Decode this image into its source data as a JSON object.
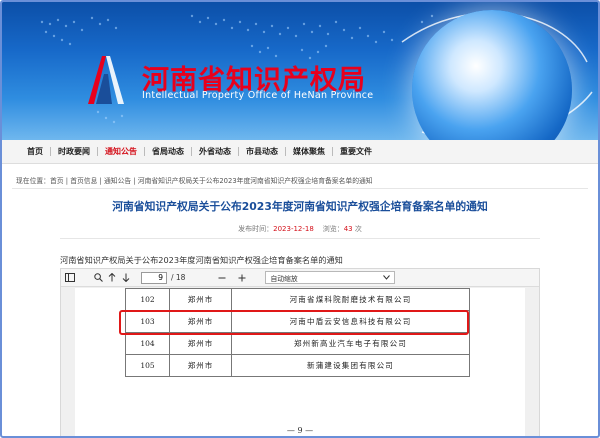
{
  "header": {
    "title_cn": "河南省知识产权局",
    "title_en": "Intellectual Property Office of HeNan Province"
  },
  "nav": {
    "items": [
      {
        "label": "首页"
      },
      {
        "label": "时政要闻"
      },
      {
        "label": "通知公告"
      },
      {
        "label": "省局动态"
      },
      {
        "label": "外省动态"
      },
      {
        "label": "市县动态"
      },
      {
        "label": "媒体聚焦"
      },
      {
        "label": "重要文件"
      }
    ],
    "active_index": 2
  },
  "breadcrumb": {
    "text": "现在位置：首页  |  首页信息  |  通知公告  |  河南省知识产权局关于公布2023年度河南省知识产权强企培育备案名单的通知"
  },
  "article": {
    "title": "河南省知识产权局关于公布2023年度河南省知识产权强企培育备案名单的通知",
    "date_label": "发布时间：",
    "date": "2023-12-18",
    "views_label": "浏览：",
    "views": "43",
    "views_unit": "次",
    "doc_caption": "河南省知识产权局关于公布2023年度河南省知识产权强企培育备案名单的通知"
  },
  "viewer": {
    "page_current": "9",
    "page_total": "/ 18",
    "zoom_label": "自动缩放",
    "rows": [
      {
        "no": "102",
        "city": "郑州市",
        "company": "河南省煤科院耐磨技术有限公司"
      },
      {
        "no": "103",
        "city": "郑州市",
        "company": "河南中盾云安信息科技有限公司"
      },
      {
        "no": "104",
        "city": "郑州市",
        "company": "郑州新高业汽车电子有限公司"
      },
      {
        "no": "105",
        "city": "郑州市",
        "company": "新蒲建设集团有限公司"
      }
    ],
    "page_footer": "— 9 —"
  },
  "colors": {
    "accent_red": "#d4101a",
    "title_blue": "#1a4e9a",
    "highlight_red": "#e01818"
  }
}
